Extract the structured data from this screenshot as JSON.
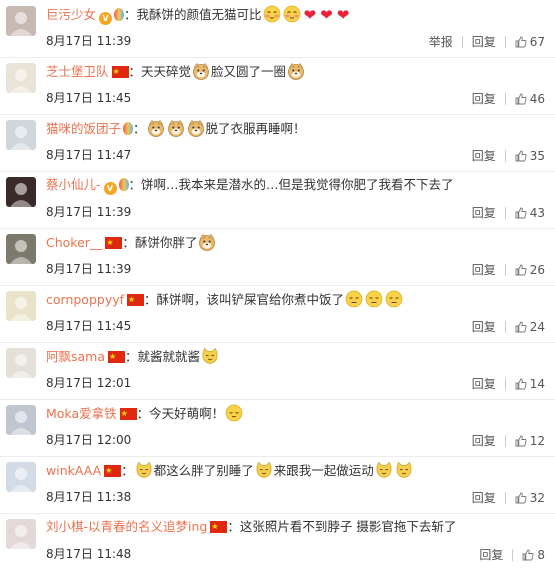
{
  "comments": [
    {
      "user": "巨污少女",
      "badges": [
        "vip",
        "balloon"
      ],
      "text": "我酥饼的颜值无猫可比",
      "emoji": [
        "shy",
        "shy",
        "heart",
        "heart",
        "heart"
      ],
      "date": "8月17日",
      "time": "11:39",
      "report": "举报",
      "reply": "回复",
      "likes": "67"
    },
    {
      "user": "芝士堡卫队",
      "badges": [
        "flag"
      ],
      "text": "天天碎觉",
      "emoji_mid": "doge",
      "text2": "脸又圆了一圈",
      "emoji": [
        "doge"
      ],
      "date": "8月17日",
      "time": "11:45",
      "reply": "回复",
      "likes": "46"
    },
    {
      "user": "猫咪的饭团子",
      "badges": [
        "balloon"
      ],
      "text": "",
      "emoji_pre": [
        "doge",
        "doge",
        "doge"
      ],
      "text2": "脱了衣服再睡啊！",
      "emoji": [],
      "date": "8月17日",
      "time": "11:47",
      "reply": "回复",
      "likes": "35"
    },
    {
      "user": "蔡小仙儿-",
      "badges": [
        "vip",
        "balloon"
      ],
      "text": "饼啊…我本来是潜水的…但是我觉得你肥了我看不下去了",
      "emoji": [],
      "date": "8月17日",
      "time": "11:39",
      "reply": "回复",
      "likes": "43"
    },
    {
      "user": "Choker__",
      "badges": [
        "flag"
      ],
      "text": "酥饼你胖了",
      "emoji": [
        "doge"
      ],
      "date": "8月17日",
      "time": "11:39",
      "reply": "回复",
      "likes": "26"
    },
    {
      "user": "cornpoppyyf",
      "badges": [
        "flag"
      ],
      "text": "酥饼啊，该叫铲屎官给你煮中饭了",
      "emoji": [
        "meh",
        "meh",
        "meh"
      ],
      "date": "8月17日",
      "time": "11:45",
      "reply": "回复",
      "likes": "24"
    },
    {
      "user": "阿飘sama",
      "badges": [
        "flag"
      ],
      "text": "就酱就就酱",
      "emoji": [
        "cat"
      ],
      "date": "8月17日",
      "time": "12:01",
      "reply": "回复",
      "likes": "14"
    },
    {
      "user": "Moka爱拿铁",
      "badges": [
        "flag"
      ],
      "text": "今天好萌啊！",
      "emoji": [
        "calm"
      ],
      "date": "8月17日",
      "time": "12:00",
      "reply": "回复",
      "likes": "12"
    },
    {
      "user": "winkAAA",
      "badges": [
        "flag"
      ],
      "text": "",
      "emoji_pre": [
        "cat"
      ],
      "text2": "都这么胖了别睡了",
      "emoji_mid": "cat",
      "text3": "来跟我一起做运动",
      "emoji": [
        "cat",
        "cat"
      ],
      "date": "8月17日",
      "time": "11:38",
      "reply": "回复",
      "likes": "32"
    },
    {
      "user": "刘小棋-以青春的名义追梦ing",
      "badges": [
        "flag"
      ],
      "text": "这张照片看不到脖子 摄影官拖下去斩了",
      "emoji": [],
      "date": "8月17日",
      "time": "11:48",
      "reply": "回复",
      "likes": "8"
    }
  ]
}
